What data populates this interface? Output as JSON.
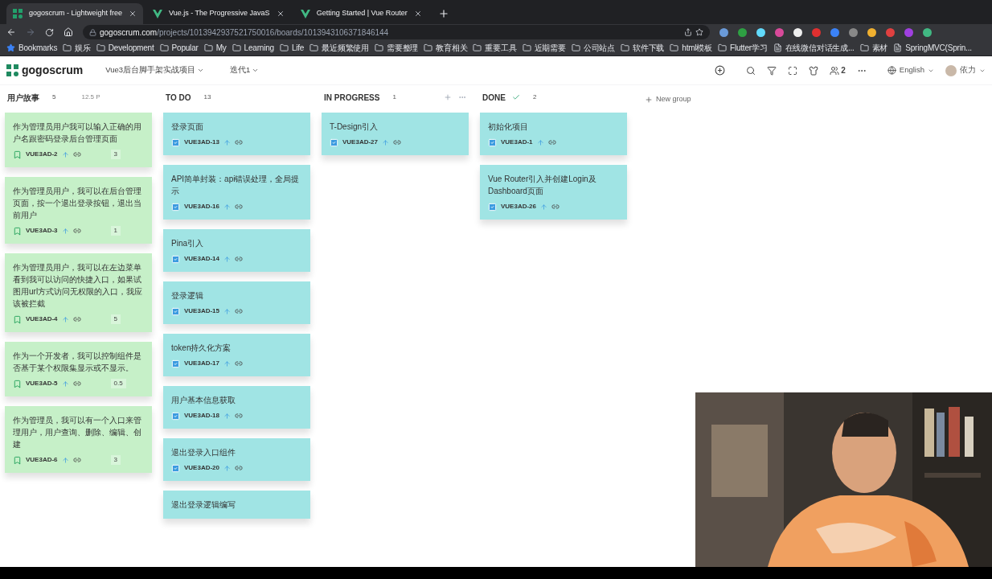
{
  "browser": {
    "tabs": [
      {
        "title": "gogoscrum - Lightweight free",
        "selected": true,
        "kind": "grid"
      },
      {
        "title": "Vue.js - The Progressive JavaS",
        "selected": false,
        "kind": "vue"
      },
      {
        "title": "Getting Started | Vue Router",
        "selected": false,
        "kind": "vue"
      }
    ],
    "address": {
      "host": "gogoscrum.com",
      "path": "/projects/1013942937521750016/boards/1013943106371846144"
    },
    "bookmarks": [
      {
        "label": "Bookmarks",
        "kind": "star"
      },
      {
        "label": "娱乐",
        "kind": "folder"
      },
      {
        "label": "Development",
        "kind": "folder"
      },
      {
        "label": "Popular",
        "kind": "folder"
      },
      {
        "label": "My",
        "kind": "folder"
      },
      {
        "label": "Learning",
        "kind": "folder"
      },
      {
        "label": "Life",
        "kind": "folder"
      },
      {
        "label": "最近频繁使用",
        "kind": "folder"
      },
      {
        "label": "需要整理",
        "kind": "folder"
      },
      {
        "label": "教育相关",
        "kind": "folder"
      },
      {
        "label": "重要工具",
        "kind": "folder"
      },
      {
        "label": "近期需要",
        "kind": "folder"
      },
      {
        "label": "公司站点",
        "kind": "folder"
      },
      {
        "label": "软件下载",
        "kind": "folder"
      },
      {
        "label": "html模板",
        "kind": "folder"
      },
      {
        "label": "Flutter学习",
        "kind": "folder"
      },
      {
        "label": "在线微信对话生成...",
        "kind": "page"
      },
      {
        "label": "素材",
        "kind": "folder"
      },
      {
        "label": "SpringMVC(Sprin...",
        "kind": "page"
      }
    ]
  },
  "app": {
    "logo": "gogoscrum",
    "project": "Vue3后台脚手架实战项目",
    "sprint": "迭代1",
    "members": "2",
    "language": "English",
    "user": "依力"
  },
  "board": {
    "columns": [
      {
        "name": "用户故事",
        "count": "5",
        "points": "12.5 P",
        "done": false,
        "actions": false,
        "cards": [
          {
            "kind": "story",
            "title": "作为管理员用户我可以输入正确的用户名跟密码登录后台管理页面",
            "id": "VUE3AD-2",
            "points": "3"
          },
          {
            "kind": "story",
            "title": "作为管理员用户，我可以在后台管理页面，按一个退出登录按钮，退出当前用户",
            "id": "VUE3AD-3",
            "points": "1"
          },
          {
            "kind": "story",
            "title": "作为管理员用户，我可以在左边菜单看到我可以访问的快捷入口，如果试图用url方式访问无权限的入口，我应该被拦截",
            "id": "VUE3AD-4",
            "points": "5"
          },
          {
            "kind": "story",
            "title": "作为一个开发者，我可以控制组件是否基于某个权限集显示或不显示。",
            "id": "VUE3AD-5",
            "points": "0.5"
          },
          {
            "kind": "story",
            "title": "作为管理员，我可以有一个入口来管理用户，用户查询、删除、编辑、创建",
            "id": "VUE3AD-6",
            "points": "3"
          }
        ]
      },
      {
        "name": "TO DO",
        "count": "13",
        "done": false,
        "actions": false,
        "cards": [
          {
            "kind": "task",
            "title": "登录页面",
            "id": "VUE3AD-13"
          },
          {
            "kind": "task",
            "title": "API简单封装：api错误处理，全局提示",
            "id": "VUE3AD-16"
          },
          {
            "kind": "task",
            "title": "Pina引入",
            "id": "VUE3AD-14"
          },
          {
            "kind": "task",
            "title": "登录逻辑",
            "id": "VUE3AD-15"
          },
          {
            "kind": "task",
            "title": "token持久化方案",
            "id": "VUE3AD-17"
          },
          {
            "kind": "task",
            "title": "用户基本信息获取",
            "id": "VUE3AD-18"
          },
          {
            "kind": "task",
            "title": "退出登录入口组件",
            "id": "VUE3AD-20"
          },
          {
            "kind": "task",
            "title": "退出登录逻辑编写"
          }
        ]
      },
      {
        "name": "IN PROGRESS",
        "count": "1",
        "done": false,
        "actions": true,
        "cards": [
          {
            "kind": "task",
            "title": "T-Design引入",
            "id": "VUE3AD-27"
          }
        ]
      },
      {
        "name": "DONE",
        "count": "2",
        "done": true,
        "actions": false,
        "cards": [
          {
            "kind": "task",
            "title": "初始化项目",
            "id": "VUE3AD-1"
          },
          {
            "kind": "task",
            "title": "Vue Router引入并创建Login及Dashboard页面",
            "id": "VUE3AD-26"
          }
        ]
      }
    ],
    "new_group": "New group"
  }
}
